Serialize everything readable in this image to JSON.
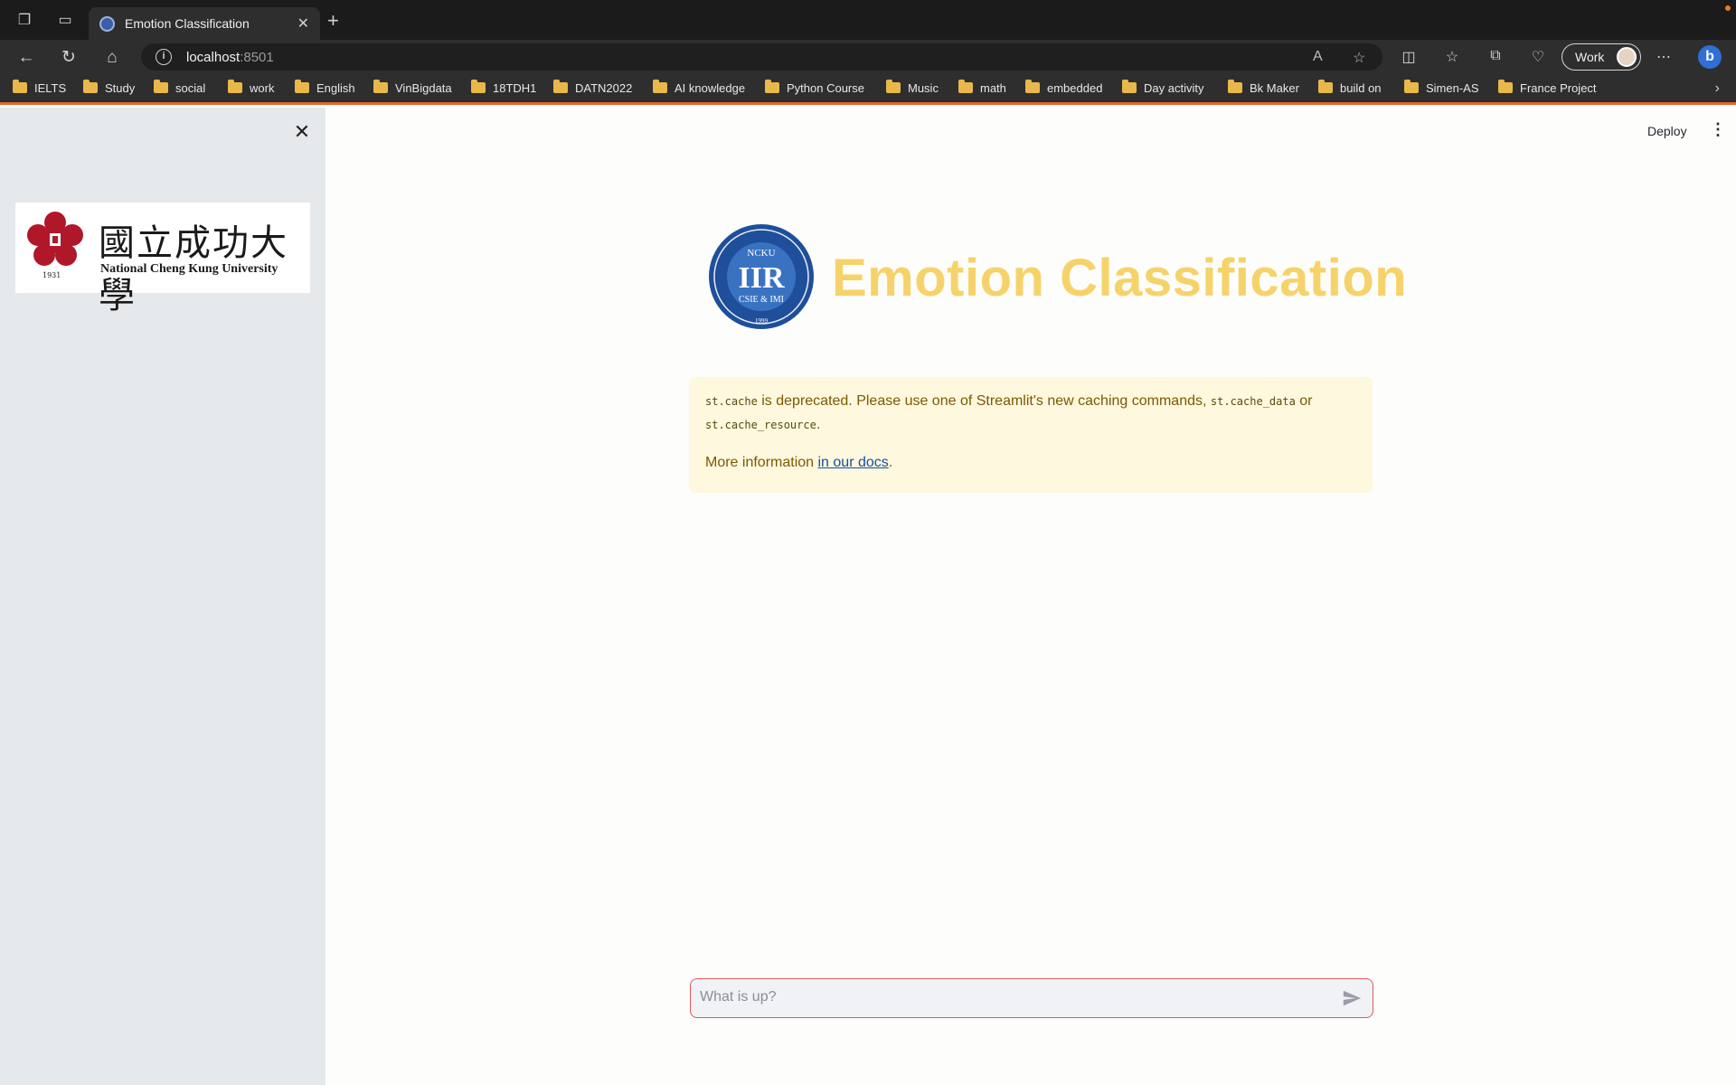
{
  "browser": {
    "tab_title": "Emotion Classification",
    "url_host": "localhost",
    "url_port": ":8501",
    "profile_name": "Work",
    "bookmarks": [
      "IELTS",
      "Study",
      "social",
      "work",
      "English",
      "VinBigdata",
      "18TDH1",
      "DATN2022",
      "AI knowledge",
      "Python Course",
      "Music",
      "math",
      "embedded",
      "Day activity",
      "Bk Maker",
      "build on",
      "Simen-AS",
      "France Project"
    ]
  },
  "sidebar": {
    "logo_cn": "國立成功大學",
    "logo_en": "National Cheng Kung University",
    "logo_year": "1931"
  },
  "header": {
    "deploy_label": "Deploy"
  },
  "main": {
    "title": "Emotion Classification",
    "iir_logo": {
      "center": "IIR",
      "top": "NCKU",
      "bottom": "CSIE & IMI",
      "year": "1999"
    },
    "warning": {
      "code1": "st.cache",
      "text1": " is deprecated. Please use one of Streamlit's new caching commands, ",
      "code2": "st.cache_data",
      "text2": " or",
      "code3": "st.cache_resource",
      "text3": ".",
      "more_prefix": "More information ",
      "link_text": "in our docs",
      "more_suffix": "."
    },
    "chat_placeholder": "What is up?"
  }
}
